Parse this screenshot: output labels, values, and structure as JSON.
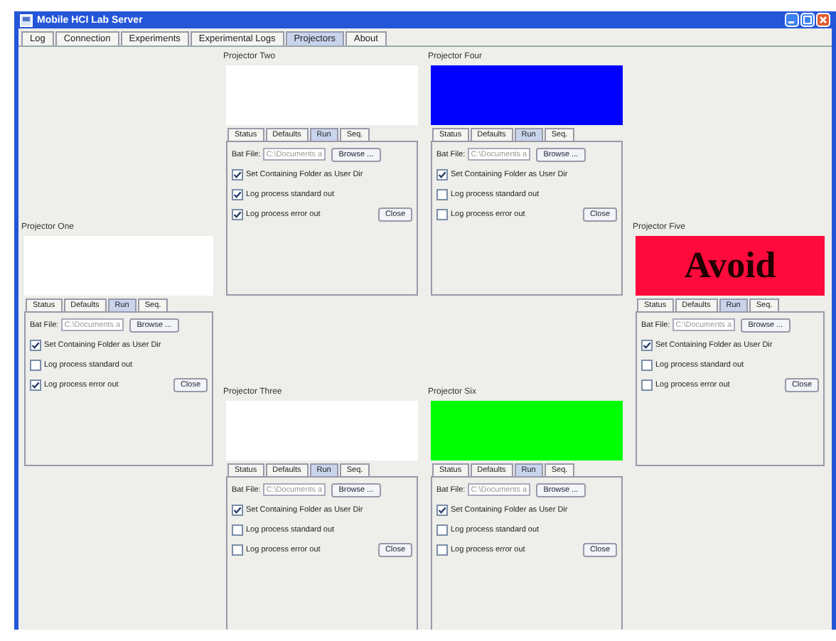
{
  "window": {
    "title": "Mobile HCI Lab Server"
  },
  "tabs": [
    {
      "label": "Log",
      "selected": false
    },
    {
      "label": "Connection",
      "selected": false
    },
    {
      "label": "Experiments",
      "selected": false
    },
    {
      "label": "Experimental Logs",
      "selected": false
    },
    {
      "label": "Projectors",
      "selected": true
    },
    {
      "label": "About",
      "selected": false
    }
  ],
  "columns": [
    [
      {
        "title": "Projector One",
        "display": {
          "color": "#ffffff"
        },
        "tabs": [
          {
            "label": "Status",
            "selected": false
          },
          {
            "label": "Defaults",
            "selected": false
          },
          {
            "label": "Run",
            "selected": true
          },
          {
            "label": "Seq.",
            "selected": false
          }
        ],
        "bat_label": "Bat File:",
        "bat_value": "C:\\Documents a",
        "browse": "Browse ...",
        "options": [
          {
            "label": "Set Containing Folder as User Dir",
            "checked": true
          },
          {
            "label": "Log process standard out",
            "checked": false
          },
          {
            "label": "Log process error out",
            "checked": true
          }
        ],
        "close": "Close"
      }
    ],
    [
      {
        "title": "Projector Two",
        "display": {
          "color": "#ffffff"
        },
        "tabs": [
          {
            "label": "Status",
            "selected": false
          },
          {
            "label": "Defaults",
            "selected": false
          },
          {
            "label": "Run",
            "selected": true
          },
          {
            "label": "Seq.",
            "selected": false
          }
        ],
        "bat_label": "Bat File:",
        "bat_value": "C:\\Documents a",
        "browse": "Browse ...",
        "options": [
          {
            "label": "Set Containing Folder as User Dir",
            "checked": true
          },
          {
            "label": "Log process standard out",
            "checked": true
          },
          {
            "label": "Log process error out",
            "checked": true
          }
        ],
        "close": "Close"
      },
      {
        "title": "Projector Three",
        "display": {
          "color": "#ffffff"
        },
        "tabs": [
          {
            "label": "Status",
            "selected": false
          },
          {
            "label": "Defaults",
            "selected": false
          },
          {
            "label": "Run",
            "selected": true
          },
          {
            "label": "Seq.",
            "selected": false
          }
        ],
        "bat_label": "Bat File:",
        "bat_value": "C:\\Documents a",
        "browse": "Browse ...",
        "options": [
          {
            "label": "Set Containing Folder as User Dir",
            "checked": true
          },
          {
            "label": "Log process standard out",
            "checked": false
          },
          {
            "label": "Log process error out",
            "checked": false
          }
        ],
        "close": "Close"
      }
    ],
    [
      {
        "title": "Projector Four",
        "display": {
          "color": "#0000ff"
        },
        "tabs": [
          {
            "label": "Status",
            "selected": false
          },
          {
            "label": "Defaults",
            "selected": false
          },
          {
            "label": "Run",
            "selected": true
          },
          {
            "label": "Seq.",
            "selected": false
          }
        ],
        "bat_label": "Bat File:",
        "bat_value": "C:\\Documents a",
        "browse": "Browse ...",
        "options": [
          {
            "label": "Set Containing Folder as User Dir",
            "checked": true
          },
          {
            "label": "Log process standard out",
            "checked": false
          },
          {
            "label": "Log process error out",
            "checked": false
          }
        ],
        "close": "Close"
      },
      {
        "title": "Projector Six",
        "display": {
          "color": "#00ff00"
        },
        "tabs": [
          {
            "label": "Status",
            "selected": false
          },
          {
            "label": "Defaults",
            "selected": false
          },
          {
            "label": "Run",
            "selected": true
          },
          {
            "label": "Seq.",
            "selected": false
          }
        ],
        "bat_label": "Bat File:",
        "bat_value": "C:\\Documents a",
        "browse": "Browse ...",
        "options": [
          {
            "label": "Set Containing Folder as User Dir",
            "checked": true
          },
          {
            "label": "Log process standard out",
            "checked": false
          },
          {
            "label": "Log process error out",
            "checked": false
          }
        ],
        "close": "Close"
      }
    ],
    [
      {
        "title": "Projector Five",
        "display": {
          "color": "#ff0a3c",
          "text": "Avoid"
        },
        "tabs": [
          {
            "label": "Status",
            "selected": false
          },
          {
            "label": "Defaults",
            "selected": false
          },
          {
            "label": "Run",
            "selected": true
          },
          {
            "label": "Seq.",
            "selected": false
          }
        ],
        "bat_label": "Bat File:",
        "bat_value": "C:\\Documents a",
        "browse": "Browse ...",
        "options": [
          {
            "label": "Set Containing Folder as User Dir",
            "checked": true
          },
          {
            "label": "Log process standard out",
            "checked": false
          },
          {
            "label": "Log process error out",
            "checked": false
          }
        ],
        "close": "Close"
      }
    ]
  ]
}
